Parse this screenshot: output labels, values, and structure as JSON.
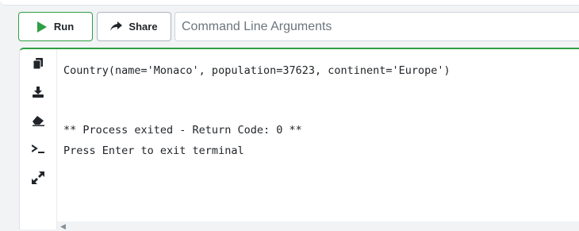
{
  "toolbar": {
    "run_label": "Run",
    "share_label": "Share",
    "args_placeholder": "Command Line Arguments",
    "args_value": ""
  },
  "terminal": {
    "lines": [
      "Country(name='Monaco', population=37623, continent='Europe')",
      "",
      "",
      "** Process exited - Return Code: 0 **",
      "Press Enter to exit terminal"
    ],
    "side_icons": [
      "copy-icon",
      "download-icon",
      "eraser-icon",
      "terminal-icon",
      "expand-icon"
    ]
  },
  "colors": {
    "accent": "#2f9e44",
    "text": "#212529",
    "placeholder": "#6c757d"
  }
}
